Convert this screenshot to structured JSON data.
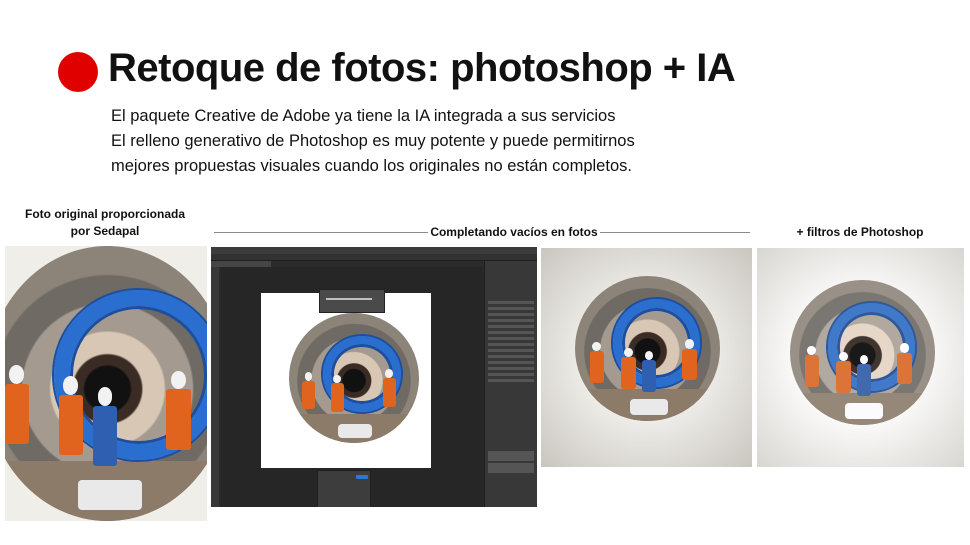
{
  "slide": {
    "title": "Retoque de fotos: photoshop + IA",
    "lines": [
      "El paquete Creative de Adobe ya tiene la IA integrada a sus servicios",
      "El relleno generativo de Photoshop es muy potente y puede permitirnos",
      "mejores propuestas visuales cuando los originales no están completos."
    ],
    "accent_color": "#e00000"
  },
  "captions": {
    "original_line1": "Foto original proporcionada",
    "original_line2": "por Sedapal",
    "middle": "Completando vacíos en fotos",
    "filters": "+ filtros de Photoshop"
  },
  "images": {
    "original": "photo-original",
    "photoshop": "photoshop-screenshot",
    "completed": "photo-completed",
    "filtered": "photo-filtered"
  }
}
